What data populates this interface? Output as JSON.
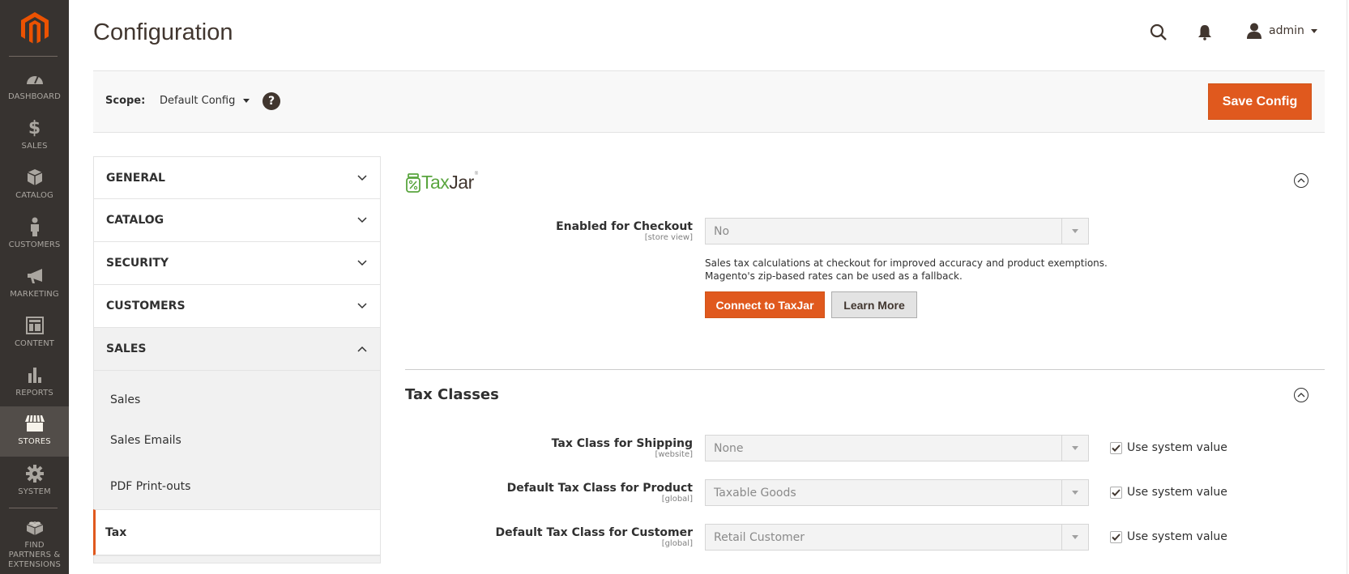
{
  "nav": {
    "logo": "magento-logo",
    "items": [
      {
        "label": "DASHBOARD",
        "icon": "dashboard-icon",
        "active": false
      },
      {
        "label": "SALES",
        "icon": "dollar-icon",
        "active": false
      },
      {
        "label": "CATALOG",
        "icon": "box-icon",
        "active": false
      },
      {
        "label": "CUSTOMERS",
        "icon": "person-icon",
        "active": false
      },
      {
        "label": "MARKETING",
        "icon": "megaphone-icon",
        "active": false
      },
      {
        "label": "CONTENT",
        "icon": "layout-icon",
        "active": false
      },
      {
        "label": "REPORTS",
        "icon": "bar-chart-icon",
        "active": false
      },
      {
        "label": "STORES",
        "icon": "storefront-icon",
        "active": true
      },
      {
        "label": "SYSTEM",
        "icon": "gear-icon",
        "active": false
      },
      {
        "label": "FIND PARTNERS & EXTENSIONS",
        "icon": "lego-brick-icon",
        "active": false
      }
    ]
  },
  "header": {
    "title": "Configuration",
    "user": "admin"
  },
  "scope": {
    "label": "Scope:",
    "value": "Default Config",
    "help": "?"
  },
  "actions": {
    "save_label": "Save Config"
  },
  "config_tabs": {
    "sections": [
      {
        "label": "GENERAL",
        "open": false
      },
      {
        "label": "CATALOG",
        "open": false
      },
      {
        "label": "SECURITY",
        "open": false
      },
      {
        "label": "CUSTOMERS",
        "open": false
      },
      {
        "label": "SALES",
        "open": true
      }
    ],
    "sales_items": [
      {
        "label": "Sales",
        "active": false
      },
      {
        "label": "Sales Emails",
        "active": false
      },
      {
        "label": "PDF Print-outs",
        "active": false
      },
      {
        "label": "Tax",
        "active": true
      }
    ]
  },
  "taxjar": {
    "logo_tax": "Tax",
    "logo_jar": "Jar",
    "logo_reg": "®",
    "enabled_label": "Enabled for Checkout",
    "enabled_scope": "[store view]",
    "enabled_value": "No",
    "note_line1": "Sales tax calculations at checkout for improved accuracy and product exemptions.",
    "note_line2": "Magento's zip-based rates can be used as a fallback.",
    "connect_label": "Connect to TaxJar",
    "learn_more_label": "Learn More"
  },
  "tax_classes": {
    "title": "Tax Classes",
    "fields": [
      {
        "label": "Tax Class for Shipping",
        "scope": "[website]",
        "value": "None",
        "use_system": true,
        "use_system_label": "Use system value"
      },
      {
        "label": "Default Tax Class for Product",
        "scope": "[global]",
        "value": "Taxable Goods",
        "use_system": true,
        "use_system_label": "Use system value"
      },
      {
        "label": "Default Tax Class for Customer",
        "scope": "[global]",
        "value": "Retail Customer",
        "use_system": true,
        "use_system_label": "Use system value"
      }
    ]
  },
  "colors": {
    "accent": "#e0591e",
    "nav_bg": "#373330",
    "nav_active": "#524d49",
    "taxjar_green": "#5aa53f"
  }
}
